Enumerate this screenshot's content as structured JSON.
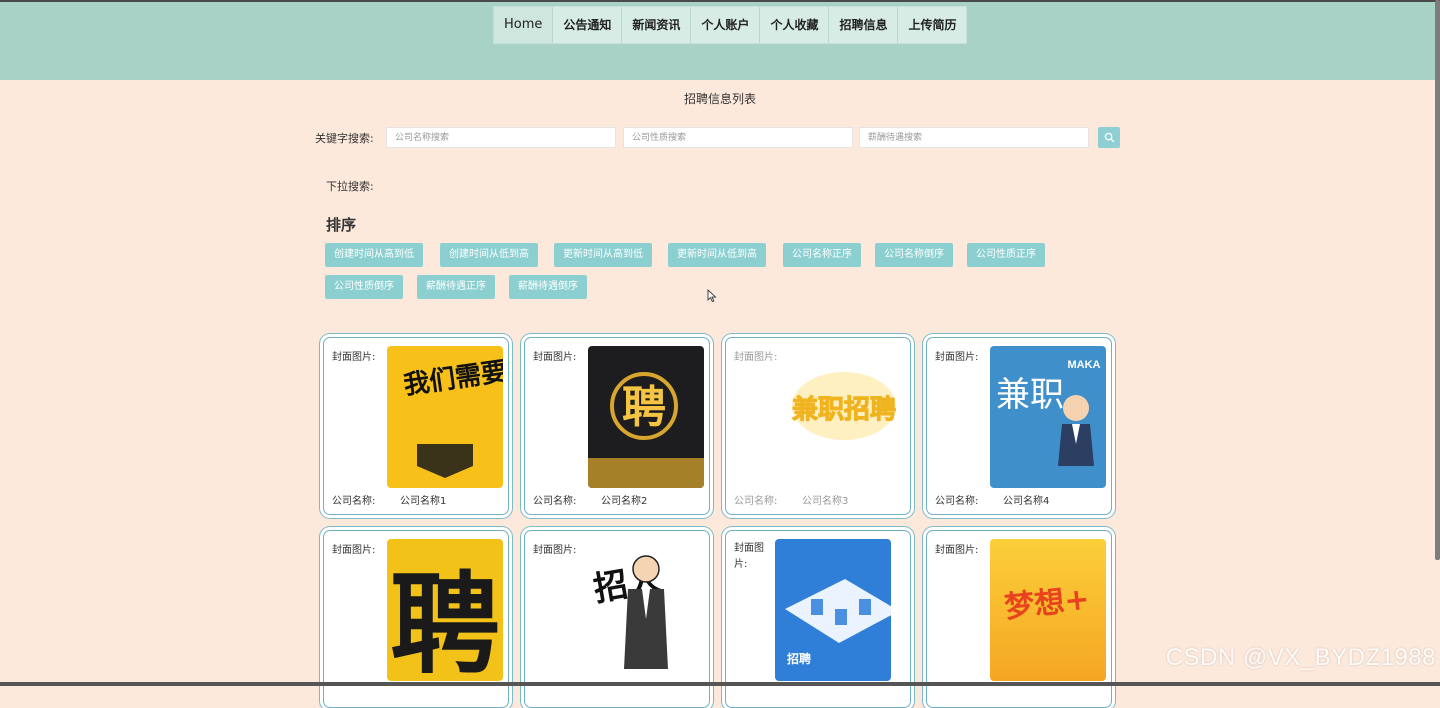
{
  "nav": {
    "items": [
      {
        "label": "Home"
      },
      {
        "label": "公告通知"
      },
      {
        "label": "新闻资讯"
      },
      {
        "label": "个人账户"
      },
      {
        "label": "个人收藏"
      },
      {
        "label": "招聘信息"
      },
      {
        "label": "上传简历"
      }
    ]
  },
  "page": {
    "title": "招聘信息列表"
  },
  "search": {
    "label": "关键字搜索:",
    "company_placeholder": "公司名称搜索",
    "nature_placeholder": "公司性质搜索",
    "salary_placeholder": "薪酬待遇搜索",
    "button_icon": "search-icon"
  },
  "dropdown_search": {
    "label": "下拉搜索:"
  },
  "sort": {
    "title": "排序",
    "buttons": [
      "创建时间从高到低",
      "创建时间从低到高",
      "更新时间从高到低",
      "更新时间从低到高",
      "公司名称正序",
      "公司名称倒序",
      "公司性质正序",
      "公司性质倒序",
      "薪酬待遇正序",
      "薪酬待遇倒序"
    ]
  },
  "cards": [
    {
      "cover_label": "封面图片:",
      "name_label": "公司名称:",
      "name_value": "公司名称1",
      "image_text": "我们需要你"
    },
    {
      "cover_label": "封面图片:",
      "name_label": "公司名称:",
      "name_value": "公司名称2",
      "image_text": "聘"
    },
    {
      "cover_label": "封面图片:",
      "name_label": "公司名称:",
      "name_value": "公司名称3",
      "image_text": "兼职招聘"
    },
    {
      "cover_label": "封面图片:",
      "name_label": "公司名称:",
      "name_value": "公司名称4",
      "image_text": "兼职"
    },
    {
      "cover_label": "封面图片:",
      "image_text": "聘"
    },
    {
      "cover_label": "封面图片:",
      "image_text": "招人"
    },
    {
      "cover_label": "封面图片:",
      "image_text": "招聘"
    },
    {
      "cover_label": "封面图片:",
      "image_text": "梦想+"
    }
  ],
  "colors": {
    "header": "#a8d2c6",
    "background": "#fde9dc",
    "accent_button": "#8ccfd0",
    "card_border": "#6fb0c2"
  },
  "watermark": "CSDN @VX_BYDZ1988"
}
